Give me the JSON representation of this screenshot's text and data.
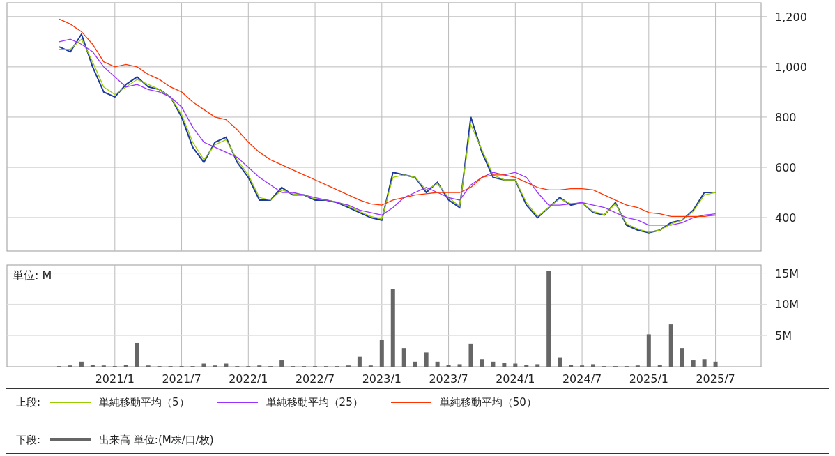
{
  "price_panel": {
    "chart_data": {
      "type": "line",
      "grid": true,
      "categories": [
        null,
        null,
        null,
        null,
        null,
        null,
        null,
        null,
        null,
        null,
        null,
        null,
        null,
        null,
        null,
        null,
        null,
        null,
        null,
        null,
        null,
        null,
        null,
        null,
        null,
        null,
        null,
        null,
        null,
        null,
        null,
        null,
        null,
        null,
        null,
        null,
        null,
        null,
        null,
        null,
        null,
        null,
        null,
        null,
        null,
        null,
        null,
        null,
        null,
        null,
        null,
        null,
        null,
        null,
        null,
        null,
        null,
        null,
        null,
        null
      ],
      "ylim": [
        267,
        1255
      ],
      "yticks": [
        {
          "value": 400,
          "label": "400"
        },
        {
          "value": 600,
          "label": "600"
        },
        {
          "value": 800,
          "label": "800"
        },
        {
          "value": 1000,
          "label": "1,000"
        },
        {
          "value": 1200,
          "label": "1,200"
        }
      ],
      "series": [
        {
          "color": "#1f3a9e",
          "values": [
            1080,
            1060,
            1130,
            1000,
            900,
            880,
            930,
            960,
            920,
            910,
            880,
            800,
            680,
            620,
            700,
            720,
            620,
            560,
            470,
            470,
            520,
            490,
            490,
            470,
            470,
            460,
            440,
            420,
            400,
            390,
            580,
            570,
            560,
            500,
            540,
            470,
            440,
            800,
            660,
            560,
            550,
            550,
            450,
            400,
            440,
            480,
            450,
            460,
            420,
            410,
            460,
            370,
            350,
            340,
            350,
            380,
            390,
            430,
            500,
            500
          ]
        },
        {
          "name": "単純移動平均（5）",
          "color": "#99cc00",
          "values": [
            1070,
            1070,
            1110,
            1020,
            920,
            890,
            920,
            950,
            930,
            910,
            880,
            810,
            700,
            630,
            690,
            710,
            630,
            570,
            480,
            470,
            510,
            495,
            490,
            475,
            470,
            462,
            445,
            425,
            405,
            395,
            560,
            570,
            560,
            510,
            535,
            480,
            445,
            770,
            670,
            570,
            550,
            550,
            460,
            405,
            440,
            475,
            455,
            458,
            425,
            412,
            455,
            375,
            355,
            342,
            350,
            375,
            390,
            425,
            490,
            500
          ]
        },
        {
          "name": "単純移動平均（25）",
          "color": "#9933ff",
          "values": [
            1100,
            1110,
            1090,
            1060,
            1000,
            960,
            920,
            930,
            910,
            900,
            880,
            840,
            760,
            700,
            680,
            660,
            640,
            600,
            560,
            530,
            500,
            500,
            490,
            480,
            470,
            460,
            450,
            430,
            420,
            410,
            440,
            480,
            500,
            520,
            500,
            480,
            470,
            530,
            560,
            580,
            570,
            580,
            560,
            500,
            450,
            450,
            455,
            460,
            450,
            440,
            420,
            400,
            390,
            370,
            370,
            370,
            380,
            400,
            410,
            415
          ]
        },
        {
          "name": "単純移動平均（50）",
          "color": "#ff3300",
          "values": [
            1190,
            1170,
            1140,
            1090,
            1020,
            1000,
            1010,
            1000,
            970,
            950,
            920,
            900,
            860,
            830,
            800,
            790,
            750,
            700,
            660,
            630,
            610,
            590,
            570,
            550,
            530,
            510,
            490,
            470,
            455,
            450,
            470,
            480,
            490,
            495,
            500,
            500,
            500,
            520,
            560,
            570,
            570,
            560,
            540,
            520,
            510,
            510,
            515,
            515,
            510,
            490,
            470,
            450,
            440,
            420,
            415,
            405,
            405,
            405,
            405,
            410
          ]
        }
      ]
    }
  },
  "volume_panel": {
    "unit_label": "単位: M",
    "chart_data": {
      "type": "bar",
      "grid": true,
      "categories": [
        null,
        null,
        null,
        null,
        null,
        "2021/1",
        null,
        null,
        null,
        null,
        null,
        "2021/7",
        null,
        null,
        null,
        null,
        null,
        "2022/1",
        null,
        null,
        null,
        null,
        null,
        "2022/7",
        null,
        null,
        null,
        null,
        null,
        "2023/1",
        null,
        null,
        null,
        null,
        null,
        "2023/7",
        null,
        null,
        null,
        null,
        null,
        "2024/1",
        null,
        null,
        null,
        null,
        null,
        "2024/7",
        null,
        null,
        null,
        null,
        null,
        "2025/1",
        null,
        null,
        null,
        null,
        null,
        "2025/7"
      ],
      "ylim": [
        0,
        16.3
      ],
      "yticks": [
        {
          "value": 5,
          "label": "5M"
        },
        {
          "value": 10,
          "label": "10M"
        },
        {
          "value": 15,
          "label": "15M"
        }
      ],
      "series": [
        {
          "name": "出来高 単位:(M株/口/枚)",
          "color": "#666666",
          "values": [
            0.1,
            0.2,
            0.8,
            0.3,
            0.2,
            0.1,
            0.3,
            3.8,
            0.2,
            0.1,
            0.1,
            0.1,
            0.1,
            0.5,
            0.2,
            0.5,
            0.1,
            0.1,
            0.2,
            0.1,
            1.0,
            0.1,
            0.1,
            0.1,
            0.1,
            0.1,
            0.2,
            1.6,
            0.2,
            4.3,
            12.5,
            3,
            0.8,
            2.3,
            0.8,
            0.3,
            0.4,
            3.7,
            1.2,
            0.8,
            0.6,
            0.5,
            0.3,
            0.4,
            15.3,
            1.5,
            0.3,
            0.2,
            0.4,
            0.1,
            0.1,
            0.1,
            0.2,
            5.2,
            0.3,
            6.8,
            3,
            1,
            1.2,
            0.8
          ]
        }
      ]
    }
  },
  "legend": {
    "upper_label": "上段:",
    "lower_label": "下段:"
  }
}
